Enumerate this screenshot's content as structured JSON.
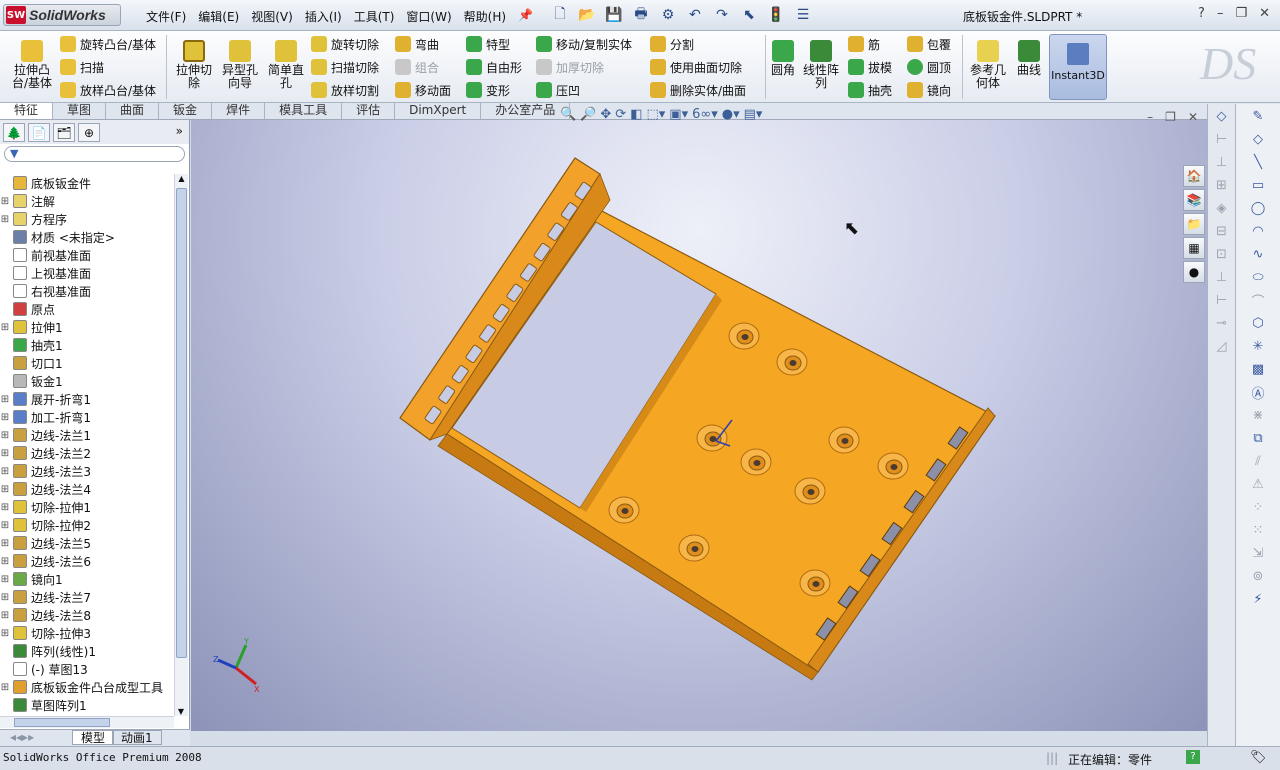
{
  "app": {
    "logo_text": "SolidWorks",
    "document_title": "底板钣金件.SLDPRT *"
  },
  "menu": [
    "文件(F)",
    "编辑(E)",
    "视图(V)",
    "插入(I)",
    "工具(T)",
    "窗口(W)",
    "帮助(H)"
  ],
  "window_controls": [
    "?",
    "–",
    "❐",
    "✕"
  ],
  "commands": {
    "extrude_boss": "拉伸凸\n台/基体",
    "revolve_boss": "旋转凸台/基体",
    "sweep": "扫描",
    "loft_boss": "放样凸台/基体",
    "extrude_cut": "拉伸切\n除",
    "hole_wizard": "异型孔\n向导",
    "simple_hole": "简单直\n孔",
    "revolve_cut": "旋转切除",
    "sweep_cut": "扫描切除",
    "loft_cut": "放样切割",
    "flex": "弯曲",
    "combine": "组合",
    "move_face": "移动面",
    "feature": "特型",
    "freeform": "自由形",
    "deform": "变形",
    "move_copy": "移动/复制实体",
    "thicken_cut": "加厚切除",
    "indent": "压凹",
    "split": "分割",
    "surface_cut": "使用曲面切除",
    "delete_body": "删除实体/曲面",
    "fillet": "圆角",
    "linear_pattern": "线性阵\n列",
    "rib": "筋",
    "draft": "拔模",
    "shell": "抽壳",
    "wrap": "包覆",
    "dome": "圆顶",
    "mirror": "镜向",
    "ref_geometry": "参考几\n何体",
    "curves": "曲线",
    "instant3d": "Instant3D"
  },
  "tabs": [
    "特征",
    "草图",
    "曲面",
    "钣金",
    "焊件",
    "模具工具",
    "评估",
    "DimXpert",
    "办公室产品"
  ],
  "active_tab": "特征",
  "feature_tree": [
    {
      "label": "底板钣金件",
      "exp": "",
      "icon": "part-icon",
      "color": "#e8b63a"
    },
    {
      "label": "注解",
      "exp": "+",
      "icon": "annotation-icon",
      "color": "#e8d36a"
    },
    {
      "label": "方程序",
      "exp": "+",
      "icon": "equation-icon",
      "color": "#e8d36a"
    },
    {
      "label": "材质 <未指定>",
      "exp": "",
      "icon": "material-icon",
      "color": "#6b7fa8"
    },
    {
      "label": "前视基准面",
      "exp": "",
      "icon": "plane-icon",
      "color": "#ffffff"
    },
    {
      "label": "上视基准面",
      "exp": "",
      "icon": "plane-icon",
      "color": "#ffffff"
    },
    {
      "label": "右视基准面",
      "exp": "",
      "icon": "plane-icon",
      "color": "#ffffff"
    },
    {
      "label": "原点",
      "exp": "",
      "icon": "origin-icon",
      "color": "#d04040"
    },
    {
      "label": "拉伸1",
      "exp": "+",
      "icon": "extrude-icon",
      "color": "#e0c23a"
    },
    {
      "label": "抽壳1",
      "exp": "",
      "icon": "shell-icon",
      "color": "#3aa84a"
    },
    {
      "label": "切口1",
      "exp": "",
      "icon": "rip-icon",
      "color": "#c8a040"
    },
    {
      "label": "钣金1",
      "exp": "",
      "icon": "sheetmetal-icon",
      "color": "#b8b8b8"
    },
    {
      "label": "展开-折弯1",
      "exp": "+",
      "icon": "unfold-icon",
      "color": "#5a7fc8"
    },
    {
      "label": "加工-折弯1",
      "exp": "+",
      "icon": "process-bend-icon",
      "color": "#5a7fc8"
    },
    {
      "label": "边线-法兰1",
      "exp": "+",
      "icon": "edge-flange-icon",
      "color": "#c8a040"
    },
    {
      "label": "边线-法兰2",
      "exp": "+",
      "icon": "edge-flange-icon",
      "color": "#c8a040"
    },
    {
      "label": "边线-法兰3",
      "exp": "+",
      "icon": "edge-flange-icon",
      "color": "#c8a040"
    },
    {
      "label": "边线-法兰4",
      "exp": "+",
      "icon": "edge-flange-icon",
      "color": "#c8a040"
    },
    {
      "label": "切除-拉伸1",
      "exp": "+",
      "icon": "cut-extrude-icon",
      "color": "#e0c23a"
    },
    {
      "label": "切除-拉伸2",
      "exp": "+",
      "icon": "cut-extrude-icon",
      "color": "#e0c23a"
    },
    {
      "label": "边线-法兰5",
      "exp": "+",
      "icon": "edge-flange-icon",
      "color": "#c8a040"
    },
    {
      "label": "边线-法兰6",
      "exp": "+",
      "icon": "edge-flange-icon",
      "color": "#c8a040"
    },
    {
      "label": "镜向1",
      "exp": "+",
      "icon": "mirror-icon",
      "color": "#6aa84a"
    },
    {
      "label": "边线-法兰7",
      "exp": "+",
      "icon": "edge-flange-icon",
      "color": "#c8a040"
    },
    {
      "label": "边线-法兰8",
      "exp": "+",
      "icon": "edge-flange-icon",
      "color": "#c8a040"
    },
    {
      "label": "切除-拉伸3",
      "exp": "+",
      "icon": "cut-extrude-icon",
      "color": "#e0c23a"
    },
    {
      "label": "阵列(线性)1",
      "exp": "",
      "icon": "linear-pattern-icon",
      "color": "#3a8a3a"
    },
    {
      "label": "(-) 草图13",
      "exp": "",
      "icon": "sketch-icon",
      "color": "#ffffff"
    },
    {
      "label": "底板钣金件凸台成型工具",
      "exp": "+",
      "icon": "forming-tool-icon",
      "color": "#e0a030"
    },
    {
      "label": "草图阵列1",
      "exp": "",
      "icon": "sketch-pattern-icon",
      "color": "#3a8a3a"
    }
  ],
  "bottom_tabs": [
    "模型",
    "动画1"
  ],
  "status": {
    "left": "SolidWorks Office Premium 2008",
    "right": "正在编辑：零件"
  },
  "colors": {
    "part": "#f5a623",
    "part_dark": "#c77a12",
    "accent": "#3a67b3"
  }
}
